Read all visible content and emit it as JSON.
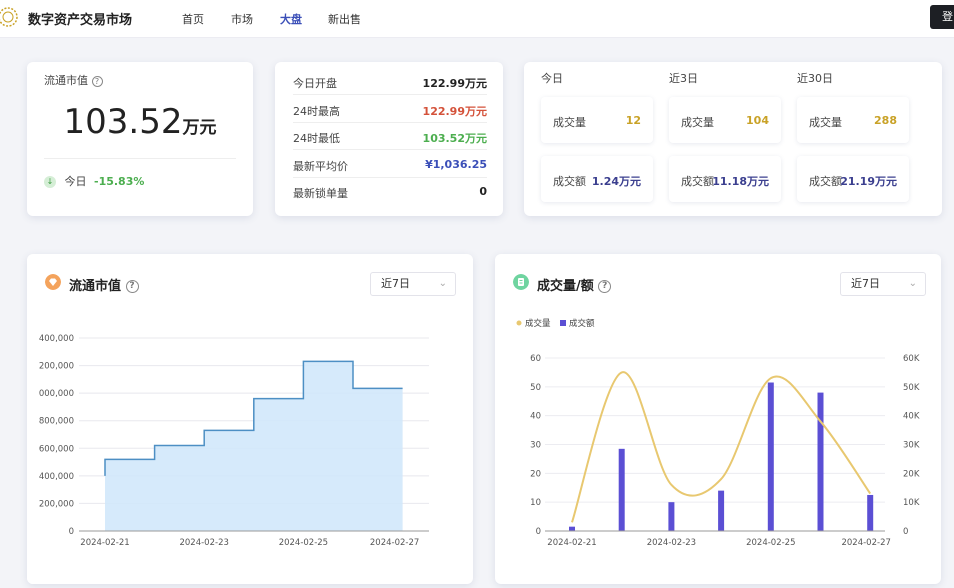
{
  "header": {
    "site_title": "数字资产交易市场",
    "nav": [
      {
        "label": "首页",
        "active": false
      },
      {
        "label": "市场",
        "active": false
      },
      {
        "label": "大盘",
        "active": true
      },
      {
        "label": "新出售",
        "active": false
      }
    ],
    "login_label": "登"
  },
  "market_cap_card": {
    "label": "流通市值",
    "value": "103.52",
    "unit": "万元",
    "today_label": "今日",
    "today_change": "-15.83%"
  },
  "price_card": {
    "rows": [
      {
        "label": "今日开盘",
        "value": "122.99万元",
        "color": "#222222"
      },
      {
        "label": "24时最高",
        "value": "122.99万元",
        "color": "#d4523a"
      },
      {
        "label": "24时最低",
        "value": "103.52万元",
        "color": "#4cae4f"
      },
      {
        "label": "最新平均价",
        "value": "¥1,036.25",
        "color": "#3b4fb8"
      },
      {
        "label": "最新锁单量",
        "value": "0",
        "color": "#222222"
      }
    ]
  },
  "period_card": {
    "periods": [
      {
        "label": "今日",
        "volume_label": "成交量",
        "volume": "12",
        "amount_label": "成交额",
        "amount": "1.24万元"
      },
      {
        "label": "近3日",
        "volume_label": "成交量",
        "volume": "104",
        "amount_label": "成交额",
        "amount": "11.18万元"
      },
      {
        "label": "近30日",
        "volume_label": "成交量",
        "volume": "288",
        "amount_label": "成交额",
        "amount": "21.19万元"
      }
    ],
    "volume_color": "#c9a227",
    "amount_color": "#3b3f8f"
  },
  "market_cap_chart": {
    "title": "流通市值",
    "select_value": "近7日"
  },
  "volume_chart": {
    "title": "成交量/额",
    "select_value": "近7日"
  },
  "chart_data": [
    {
      "type": "area",
      "title": "流通市值",
      "step": true,
      "x": [
        "2024-02-21",
        "2024-02-22",
        "2024-02-23",
        "2024-02-24",
        "2024-02-25",
        "2024-02-26",
        "2024-02-27"
      ],
      "x_ticks": [
        "2024-02-21",
        "2024-02-23",
        "2024-02-25",
        "2024-02-27"
      ],
      "values": [
        520000,
        620000,
        730000,
        960000,
        1230000,
        1035000,
        1035000
      ],
      "start_value": 400000,
      "y_ticks": [
        "0",
        "200,000",
        "400,000",
        "600,000",
        "800,000",
        "000,000",
        "200,000",
        "400,000"
      ],
      "ylim": [
        0,
        1400000
      ],
      "grid": true,
      "line_color": "#4d8fc4",
      "fill_color": "#cfe6fa"
    },
    {
      "type": "bar",
      "title": "成交量/额",
      "x": [
        "2024-02-21",
        "2024-02-22",
        "2024-02-23",
        "2024-02-24",
        "2024-02-25",
        "2024-02-26",
        "2024-02-27"
      ],
      "x_ticks": [
        "2024-02-21",
        "2024-02-23",
        "2024-02-25",
        "2024-02-27"
      ],
      "legend_position": "top-left",
      "series": [
        {
          "name": "成交量",
          "type": "line",
          "smooth": true,
          "axis": "left",
          "values": [
            3,
            55,
            16,
            18,
            53,
            38,
            13
          ],
          "color": "#e8c870"
        },
        {
          "name": "成交额",
          "type": "bar",
          "axis": "right",
          "values": [
            1500,
            28500,
            10000,
            14000,
            51500,
            48000,
            12500
          ],
          "color": "#5b4fd4"
        }
      ],
      "y_left_ticks": [
        "0",
        "10",
        "20",
        "30",
        "40",
        "50",
        "60"
      ],
      "y_right_ticks": [
        "0",
        "10K",
        "20K",
        "30K",
        "40K",
        "50K",
        "60K"
      ],
      "ylim_left": [
        0,
        60
      ],
      "ylim_right": [
        0,
        60000
      ],
      "grid": true
    }
  ]
}
